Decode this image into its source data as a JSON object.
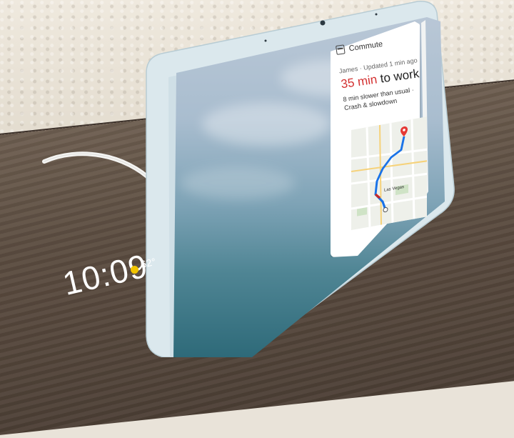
{
  "ambient": {
    "time": "10:09",
    "temperature": "62°",
    "weather_icon": "sun-icon"
  },
  "commute_card": {
    "title": "Commute",
    "title_icon": "bus-icon",
    "updated": "James · Updated 1 min ago",
    "eta_minutes": "35 min",
    "eta_suffix": " to work",
    "delay_text": "8 min slower than usual · Crash & slowdown",
    "map_label": "Las Vegas"
  },
  "colors": {
    "eta_accent": "#d32f2f",
    "route": "#1a73e8",
    "destination_pin": "#e53935",
    "sun": "#f2c400"
  }
}
